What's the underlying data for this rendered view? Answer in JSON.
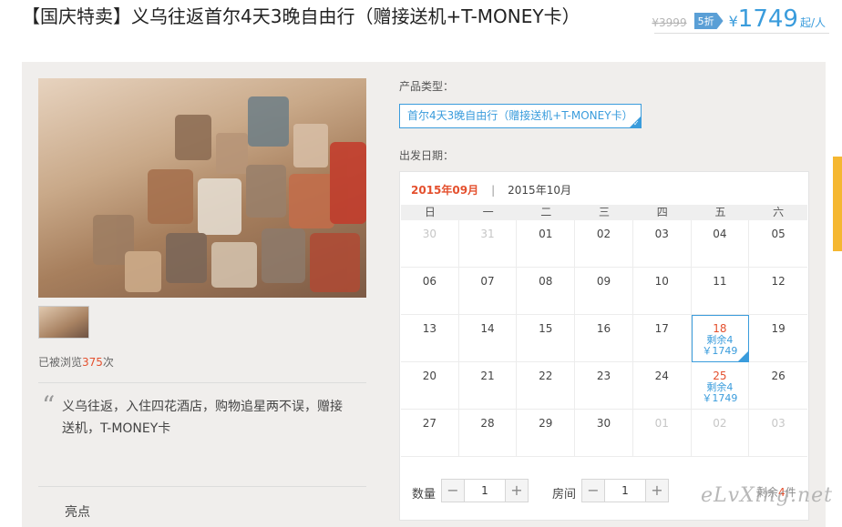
{
  "header": {
    "title": "【国庆特卖】义乌往返首尔4天3晚自由行（赠接送机+T-MONEY卡）",
    "old_price": "¥3999",
    "discount": "5折",
    "currency": "¥",
    "price": "1749",
    "unit": "起/人"
  },
  "left": {
    "views_prefix": "已被浏览",
    "views_count": "375",
    "views_suffix": "次",
    "summary": "义乌往返，入住四花酒店，购物追星两不误，赠接送机，T-MONEY卡",
    "highlights": "亮点"
  },
  "booking": {
    "product_label": "产品类型：",
    "product_value": "首尔4天3晚自由行（赠接送机+T-MONEY卡）",
    "date_label": "出发日期：",
    "months": {
      "active": "2015年09月",
      "separator": "|",
      "other": "2015年10月"
    },
    "weekdays": [
      "日",
      "一",
      "二",
      "三",
      "四",
      "五",
      "六"
    ],
    "days": [
      {
        "d": "30",
        "dim": true
      },
      {
        "d": "31",
        "dim": true
      },
      {
        "d": "01"
      },
      {
        "d": "02"
      },
      {
        "d": "03"
      },
      {
        "d": "04"
      },
      {
        "d": "05"
      },
      {
        "d": "06"
      },
      {
        "d": "07"
      },
      {
        "d": "08"
      },
      {
        "d": "09"
      },
      {
        "d": "10"
      },
      {
        "d": "11"
      },
      {
        "d": "12"
      },
      {
        "d": "13"
      },
      {
        "d": "14"
      },
      {
        "d": "15"
      },
      {
        "d": "16"
      },
      {
        "d": "17"
      },
      {
        "d": "18",
        "remain": "剩余4",
        "price": "￥1749",
        "selected": true
      },
      {
        "d": "19"
      },
      {
        "d": "20"
      },
      {
        "d": "21"
      },
      {
        "d": "22"
      },
      {
        "d": "23"
      },
      {
        "d": "24"
      },
      {
        "d": "25",
        "remain": "剩余4",
        "price": "￥1749"
      },
      {
        "d": "26"
      },
      {
        "d": "27"
      },
      {
        "d": "28"
      },
      {
        "d": "29"
      },
      {
        "d": "30"
      },
      {
        "d": "01",
        "dim": true
      },
      {
        "d": "02",
        "dim": true
      },
      {
        "d": "03",
        "dim": true
      }
    ],
    "qty_label": "数量",
    "qty_value": "1",
    "room_label": "房间",
    "room_value": "1",
    "minus": "−",
    "plus": "+",
    "stock_prefix": "剩余",
    "stock_count": "4",
    "stock_suffix": "件"
  },
  "watermark": "eLvXing.net",
  "colors": {
    "accent": "#3a9cdc",
    "highlight": "#e4502e",
    "side_tab": "#f5b731"
  }
}
